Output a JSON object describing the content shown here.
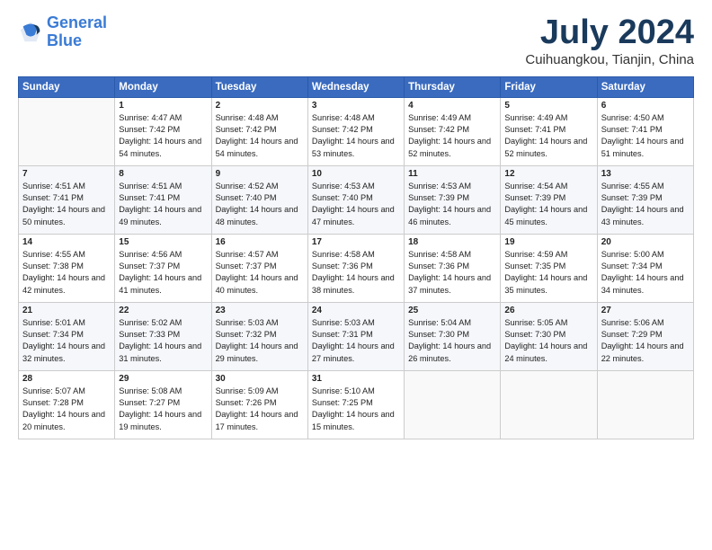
{
  "logo": {
    "line1": "General",
    "line2": "Blue"
  },
  "title": "July 2024",
  "subtitle": "Cuihuangkou, Tianjin, China",
  "header_days": [
    "Sunday",
    "Monday",
    "Tuesday",
    "Wednesday",
    "Thursday",
    "Friday",
    "Saturday"
  ],
  "weeks": [
    [
      {
        "day": "",
        "sunrise": "",
        "sunset": "",
        "daylight": ""
      },
      {
        "day": "1",
        "sunrise": "Sunrise: 4:47 AM",
        "sunset": "Sunset: 7:42 PM",
        "daylight": "Daylight: 14 hours and 54 minutes."
      },
      {
        "day": "2",
        "sunrise": "Sunrise: 4:48 AM",
        "sunset": "Sunset: 7:42 PM",
        "daylight": "Daylight: 14 hours and 54 minutes."
      },
      {
        "day": "3",
        "sunrise": "Sunrise: 4:48 AM",
        "sunset": "Sunset: 7:42 PM",
        "daylight": "Daylight: 14 hours and 53 minutes."
      },
      {
        "day": "4",
        "sunrise": "Sunrise: 4:49 AM",
        "sunset": "Sunset: 7:42 PM",
        "daylight": "Daylight: 14 hours and 52 minutes."
      },
      {
        "day": "5",
        "sunrise": "Sunrise: 4:49 AM",
        "sunset": "Sunset: 7:41 PM",
        "daylight": "Daylight: 14 hours and 52 minutes."
      },
      {
        "day": "6",
        "sunrise": "Sunrise: 4:50 AM",
        "sunset": "Sunset: 7:41 PM",
        "daylight": "Daylight: 14 hours and 51 minutes."
      }
    ],
    [
      {
        "day": "7",
        "sunrise": "Sunrise: 4:51 AM",
        "sunset": "Sunset: 7:41 PM",
        "daylight": "Daylight: 14 hours and 50 minutes."
      },
      {
        "day": "8",
        "sunrise": "Sunrise: 4:51 AM",
        "sunset": "Sunset: 7:41 PM",
        "daylight": "Daylight: 14 hours and 49 minutes."
      },
      {
        "day": "9",
        "sunrise": "Sunrise: 4:52 AM",
        "sunset": "Sunset: 7:40 PM",
        "daylight": "Daylight: 14 hours and 48 minutes."
      },
      {
        "day": "10",
        "sunrise": "Sunrise: 4:53 AM",
        "sunset": "Sunset: 7:40 PM",
        "daylight": "Daylight: 14 hours and 47 minutes."
      },
      {
        "day": "11",
        "sunrise": "Sunrise: 4:53 AM",
        "sunset": "Sunset: 7:39 PM",
        "daylight": "Daylight: 14 hours and 46 minutes."
      },
      {
        "day": "12",
        "sunrise": "Sunrise: 4:54 AM",
        "sunset": "Sunset: 7:39 PM",
        "daylight": "Daylight: 14 hours and 45 minutes."
      },
      {
        "day": "13",
        "sunrise": "Sunrise: 4:55 AM",
        "sunset": "Sunset: 7:39 PM",
        "daylight": "Daylight: 14 hours and 43 minutes."
      }
    ],
    [
      {
        "day": "14",
        "sunrise": "Sunrise: 4:55 AM",
        "sunset": "Sunset: 7:38 PM",
        "daylight": "Daylight: 14 hours and 42 minutes."
      },
      {
        "day": "15",
        "sunrise": "Sunrise: 4:56 AM",
        "sunset": "Sunset: 7:37 PM",
        "daylight": "Daylight: 14 hours and 41 minutes."
      },
      {
        "day": "16",
        "sunrise": "Sunrise: 4:57 AM",
        "sunset": "Sunset: 7:37 PM",
        "daylight": "Daylight: 14 hours and 40 minutes."
      },
      {
        "day": "17",
        "sunrise": "Sunrise: 4:58 AM",
        "sunset": "Sunset: 7:36 PM",
        "daylight": "Daylight: 14 hours and 38 minutes."
      },
      {
        "day": "18",
        "sunrise": "Sunrise: 4:58 AM",
        "sunset": "Sunset: 7:36 PM",
        "daylight": "Daylight: 14 hours and 37 minutes."
      },
      {
        "day": "19",
        "sunrise": "Sunrise: 4:59 AM",
        "sunset": "Sunset: 7:35 PM",
        "daylight": "Daylight: 14 hours and 35 minutes."
      },
      {
        "day": "20",
        "sunrise": "Sunrise: 5:00 AM",
        "sunset": "Sunset: 7:34 PM",
        "daylight": "Daylight: 14 hours and 34 minutes."
      }
    ],
    [
      {
        "day": "21",
        "sunrise": "Sunrise: 5:01 AM",
        "sunset": "Sunset: 7:34 PM",
        "daylight": "Daylight: 14 hours and 32 minutes."
      },
      {
        "day": "22",
        "sunrise": "Sunrise: 5:02 AM",
        "sunset": "Sunset: 7:33 PM",
        "daylight": "Daylight: 14 hours and 31 minutes."
      },
      {
        "day": "23",
        "sunrise": "Sunrise: 5:03 AM",
        "sunset": "Sunset: 7:32 PM",
        "daylight": "Daylight: 14 hours and 29 minutes."
      },
      {
        "day": "24",
        "sunrise": "Sunrise: 5:03 AM",
        "sunset": "Sunset: 7:31 PM",
        "daylight": "Daylight: 14 hours and 27 minutes."
      },
      {
        "day": "25",
        "sunrise": "Sunrise: 5:04 AM",
        "sunset": "Sunset: 7:30 PM",
        "daylight": "Daylight: 14 hours and 26 minutes."
      },
      {
        "day": "26",
        "sunrise": "Sunrise: 5:05 AM",
        "sunset": "Sunset: 7:30 PM",
        "daylight": "Daylight: 14 hours and 24 minutes."
      },
      {
        "day": "27",
        "sunrise": "Sunrise: 5:06 AM",
        "sunset": "Sunset: 7:29 PM",
        "daylight": "Daylight: 14 hours and 22 minutes."
      }
    ],
    [
      {
        "day": "28",
        "sunrise": "Sunrise: 5:07 AM",
        "sunset": "Sunset: 7:28 PM",
        "daylight": "Daylight: 14 hours and 20 minutes."
      },
      {
        "day": "29",
        "sunrise": "Sunrise: 5:08 AM",
        "sunset": "Sunset: 7:27 PM",
        "daylight": "Daylight: 14 hours and 19 minutes."
      },
      {
        "day": "30",
        "sunrise": "Sunrise: 5:09 AM",
        "sunset": "Sunset: 7:26 PM",
        "daylight": "Daylight: 14 hours and 17 minutes."
      },
      {
        "day": "31",
        "sunrise": "Sunrise: 5:10 AM",
        "sunset": "Sunset: 7:25 PM",
        "daylight": "Daylight: 14 hours and 15 minutes."
      },
      {
        "day": "",
        "sunrise": "",
        "sunset": "",
        "daylight": ""
      },
      {
        "day": "",
        "sunrise": "",
        "sunset": "",
        "daylight": ""
      },
      {
        "day": "",
        "sunrise": "",
        "sunset": "",
        "daylight": ""
      }
    ]
  ]
}
